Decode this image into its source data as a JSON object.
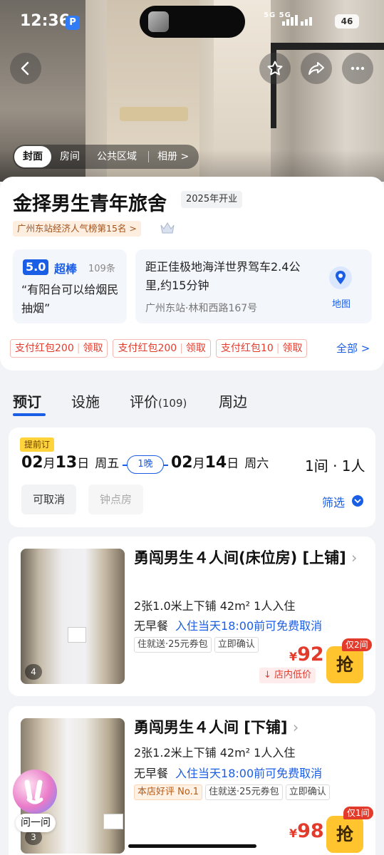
{
  "status_bar": {
    "time": "12:36",
    "network": "5G  5G",
    "battery": "46"
  },
  "photo_tabs": [
    "封面",
    "房间",
    "公共区域"
  ],
  "photo_album": "相册 >",
  "hotel": {
    "name": "金择男生青年旅舍",
    "open_tag": "2025年开业",
    "rank": "广州东站经济人气榜第15名 >",
    "rating": {
      "score": "5.0",
      "word": "超棒",
      "count": "109条",
      "review": "“有阳台可以给烟民抽烟”"
    },
    "location": {
      "distance": "距正佳极地海洋世界驾车2.4公里,约15分钟",
      "address": "广州东站·林和西路167号",
      "map_label": "地图"
    },
    "coupons": [
      {
        "label": "支付红包200",
        "action": "领取"
      },
      {
        "label": "支付红包200",
        "action": "领取"
      },
      {
        "label": "支付红包10",
        "action": "领取"
      }
    ],
    "coupons_all": "全部 >"
  },
  "tabs": [
    {
      "label": "预订",
      "count": ""
    },
    {
      "label": "设施",
      "count": ""
    },
    {
      "label": "评价",
      "count": "(109)"
    },
    {
      "label": "周边",
      "count": ""
    }
  ],
  "booking": {
    "badge": "提前订",
    "checkin": {
      "month": "02",
      "month_unit": "月",
      "day": "13",
      "day_unit": "日",
      "weekday": "周五"
    },
    "nights": "1晚",
    "checkout": {
      "month": "02",
      "month_unit": "月",
      "day": "14",
      "day_unit": "日",
      "weekday": "周六"
    },
    "rooms": "1间 · 1人",
    "chips": [
      "可取消",
      "钟点房"
    ],
    "filter": "筛选"
  },
  "rooms": [
    {
      "title": "勇闯男生４人间(床位房) [上铺]",
      "spec": "2张1.0米上下铺  42m²  1人入住",
      "meal": "无早餐",
      "cancel": "入住当天18:00前可免费取消",
      "tags": [
        "住就送·25元券包",
        "立即确认"
      ],
      "price_symbol": "¥",
      "price": "92",
      "low_tag": "店内低价",
      "buy": "抢",
      "left": "仅2间",
      "img_count": "4"
    },
    {
      "title": "勇闯男生４人间 [下铺]",
      "spec": "2张1.2米上下铺  42m²  1人入住",
      "meal": "无早餐",
      "cancel": "入住当天18:00前可免费取消",
      "hot_tag": "本店好评 No.1",
      "tags": [
        "住就送·25元券包",
        "立即确认"
      ],
      "price_symbol": "¥",
      "price": "98",
      "buy": "抢",
      "left": "仅1间",
      "img_count": "3"
    }
  ],
  "assistant": {
    "label": "问一问"
  }
}
